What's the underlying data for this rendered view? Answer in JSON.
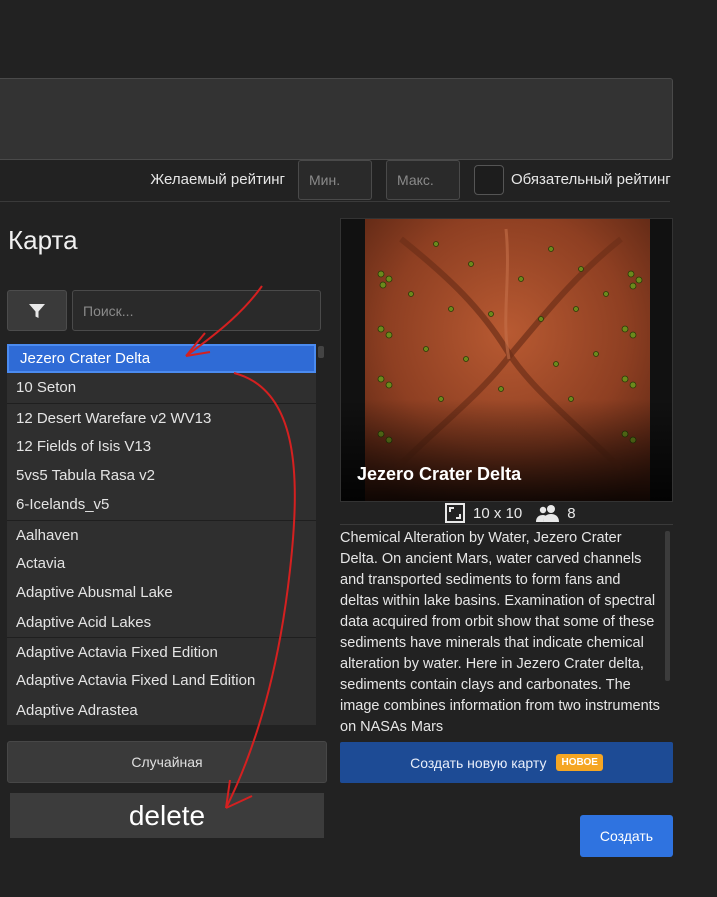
{
  "rating": {
    "label": "Желаемый рейтинг",
    "min_placeholder": "Мин.",
    "max_placeholder": "Макс.",
    "required_label": "Обязательный рейтинг"
  },
  "map_section": {
    "title": "Карта",
    "search_placeholder": "Поиск...",
    "items": [
      {
        "label": "Jezero Crater Delta",
        "selected": true
      },
      {
        "label": "10 Seton"
      },
      {
        "label": "12 Desert Warefare v2 WV13"
      },
      {
        "label": "12 Fields of Isis V13"
      },
      {
        "label": "5vs5 Tabula Rasa v2"
      },
      {
        "label": "6-Icelands_v5"
      },
      {
        "label": "Aalhaven"
      },
      {
        "label": "Actavia"
      },
      {
        "label": "Adaptive Abusmal Lake"
      },
      {
        "label": "Adaptive Acid Lakes"
      },
      {
        "label": "Adaptive Actavia Fixed Edition"
      },
      {
        "label": "Adaptive Actavia Fixed Land Edition"
      },
      {
        "label": "Adaptive Adrastea"
      }
    ],
    "random_label": "Случайная",
    "delete_label": "delete"
  },
  "preview": {
    "title": "Jezero Crater Delta",
    "size": "10 x 10",
    "players": "8",
    "description": "Chemical Alteration by Water, Jezero Crater Delta. On ancient Mars, water carved channels and transported sediments to form fans and deltas within lake basins. Examination of spectral data acquired from orbit show that some of these sediments have minerals that indicate chemical alteration by water. Here in Jezero Crater delta, sediments contain clays and carbonates. The image combines information from two instruments on NASAs Mars"
  },
  "actions": {
    "new_map_label": "Создать новую карту",
    "new_badge": "НОВОЕ",
    "create_label": "Создать"
  },
  "colors": {
    "background": "#222222",
    "selection": "#2f6bd6",
    "primary_button": "#2f73e0",
    "new_map_button": "#1d4b95",
    "badge": "#f5a623",
    "annotation_red": "#d42020"
  }
}
